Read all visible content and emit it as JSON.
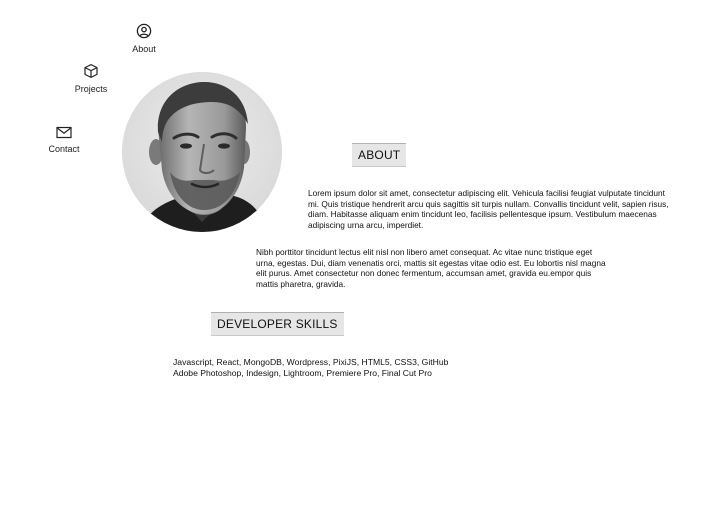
{
  "nav": {
    "items": [
      {
        "label": "About",
        "icon": "user-circle-icon"
      },
      {
        "label": "Projects",
        "icon": "cube-icon"
      },
      {
        "label": "Contact",
        "icon": "envelope-icon"
      }
    ]
  },
  "about": {
    "heading": "ABOUT",
    "paragraphs": [
      "Lorem ipsum dolor sit amet, consectetur adipiscing elit. Vehicula facilisi feugiat vulputate tincidunt mi. Quis tristique hendrerit arcu quis sagittis sit turpis nullam. Convallis tincidunt velit, sapien risus, diam. Habitasse aliquam enim tincidunt leo, facilisis pellentesque ipsum. Vestibulum maecenas adipiscing urna arcu, imperdiet.",
      "Nibh porttitor tincidunt lectus elit nisl non libero amet consequat. Ac vitae nunc tristique eget urna, egestas. Dui, diam venenatis orci, mattis sit egestas vitae odio est. Eu lobortis nisl magna elit purus. Amet consectetur non donec fermentum, accumsan amet, gravida eu.empor quis mattis pharetra, gravida."
    ]
  },
  "skills": {
    "heading": "DEVELOPER SKILLS",
    "lines": [
      "Javascript, React, MongoDB, Wordpress, PixiJS, HTML5, CSS3, GitHub",
      "Adobe Photoshop, Indesign, Lightroom, Premiere Pro, Final Cut Pro"
    ]
  },
  "colors": {
    "heading_bg": "#e6e6e6",
    "text": "#111111",
    "avatar_bg": "#e3e3e3"
  }
}
